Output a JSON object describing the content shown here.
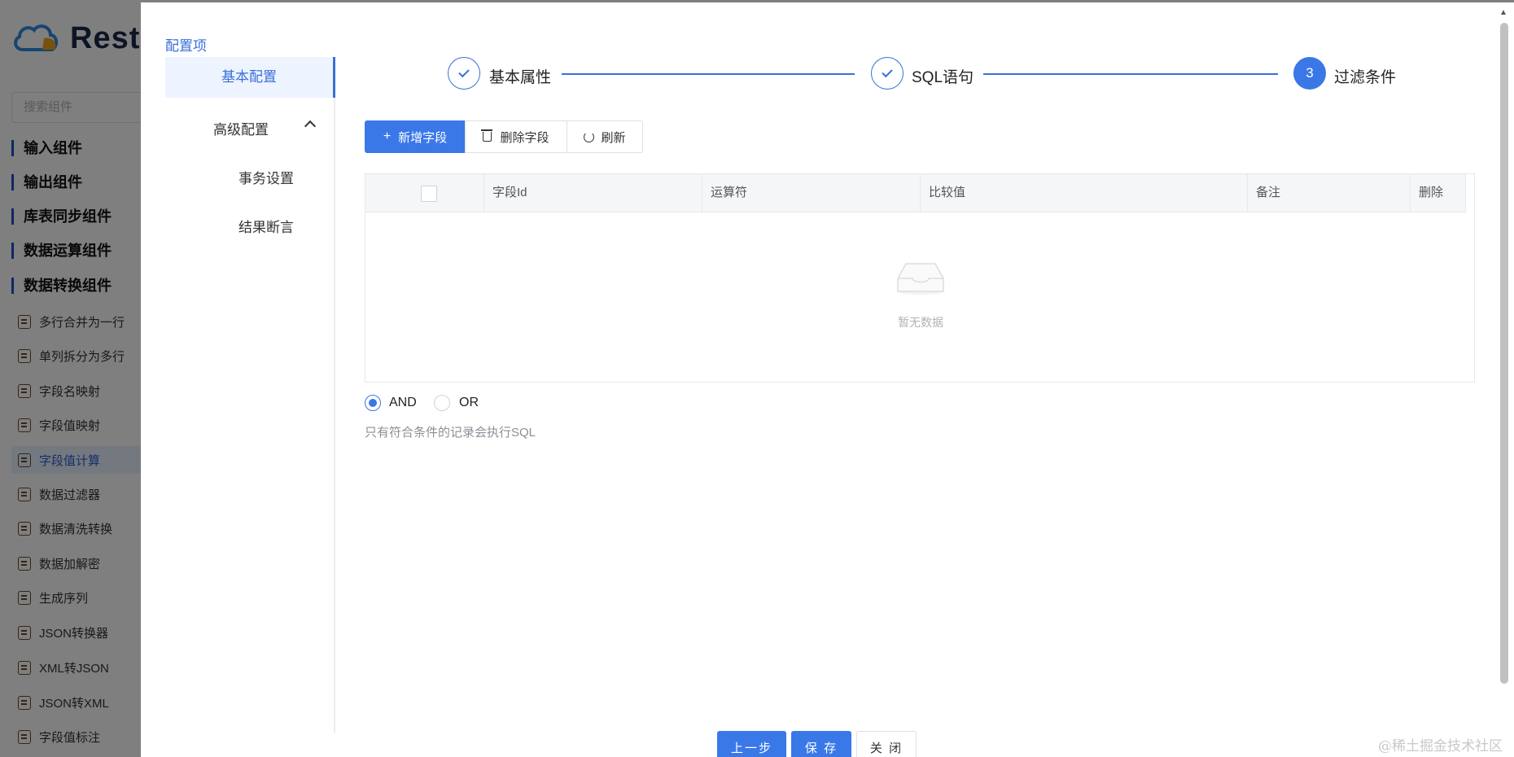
{
  "background_app": {
    "logo_text": "Rest",
    "search_placeholder": "搜索组件",
    "groups": [
      "输入组件",
      "输出组件",
      "库表同步组件",
      "数据运算组件",
      "数据转换组件"
    ],
    "items": [
      "多行合并为一行",
      "单列拆分为多行",
      "字段名映射",
      "字段值映射",
      "字段值计算",
      "数据过滤器",
      "数据清洗转换",
      "数据加解密",
      "生成序列",
      "JSON转换器",
      "XML转JSON",
      "JSON转XML",
      "字段值标注"
    ],
    "active_item": "字段值计算"
  },
  "config_nav": {
    "title": "配置项",
    "basic": "基本配置",
    "advanced": "高级配置",
    "transaction": "事务设置",
    "assertion": "结果断言"
  },
  "steps": [
    {
      "label": "基本属性",
      "status": "done"
    },
    {
      "label": "SQL语句",
      "status": "done"
    },
    {
      "label": "过滤条件",
      "status": "active",
      "number": "3"
    }
  ],
  "toolbar": {
    "add_label": "新增字段",
    "delete_label": "删除字段",
    "refresh_label": "刷新"
  },
  "table": {
    "columns": [
      "字段Id",
      "运算符",
      "比较值",
      "备注",
      "删除"
    ],
    "rows": [],
    "empty_text": "暂无数据"
  },
  "logic": {
    "options": [
      "AND",
      "OR"
    ],
    "selected": "AND",
    "hint": "只有符合条件的记录会执行SQL"
  },
  "footer": {
    "prev_label": "上一步",
    "save_label": "保 存",
    "close_label": "关 闭"
  },
  "watermark": "@稀土掘金技术社区",
  "colors": {
    "primary": "#3a78e8",
    "nav_active_bg": "#eef4ff"
  }
}
